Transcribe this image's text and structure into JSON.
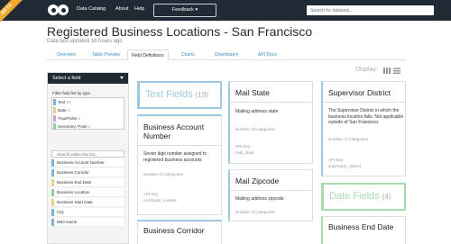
{
  "nav": {
    "beta": "BETA",
    "links": [
      "Data Catalog",
      "About",
      "Help"
    ],
    "feedback": "Feedback",
    "search_placeholder": "Search for datasets..."
  },
  "page": {
    "title": "Registered Business Locations - San Francisco",
    "updated": "Data last updated 18 hours ago"
  },
  "tabs": [
    "Overview",
    "Table Preview",
    "Field Definitions",
    "Charts",
    "Download",
    "API Docs"
  ],
  "display_label": "Display:",
  "sidebar": {
    "header": "Select a field",
    "filter_label": "Filter field list by type",
    "types": [
      {
        "label": "Text",
        "count": "19",
        "color": "#7fb3d5"
      },
      {
        "label": "Date",
        "count": "4",
        "color": "#e8d28a"
      },
      {
        "label": "True/False",
        "count": "2",
        "color": "#c3a3d9"
      },
      {
        "label": "Geometry: Point",
        "count": "1",
        "color": "#8fd19e"
      }
    ],
    "search_placeholder": "Search within this list...",
    "fields": [
      {
        "label": "Business Account Number",
        "color": "#7fb3d5"
      },
      {
        "label": "Business Corridor",
        "color": "#7fb3d5"
      },
      {
        "label": "Business End Date",
        "color": "#e8d28a"
      },
      {
        "label": "Business Location",
        "color": "#8fd19e"
      },
      {
        "label": "Business Start Date",
        "color": "#e8d28a"
      },
      {
        "label": "City",
        "color": "#7fb3d5"
      },
      {
        "label": "DBA Name",
        "color": "#7fb3d5"
      }
    ]
  },
  "cards": {
    "text_fields": {
      "title": "Text Fields",
      "count": "(19)",
      "color": "#9ec9e3"
    },
    "business_account": {
      "title": "Business Account Number",
      "desc": "Seven digit number assigned to registered business accounts",
      "meta1": "Number of Categories",
      "meta2": "API Key",
      "meta2_val": "certificate_number",
      "color": "#9ec9e3"
    },
    "business_corridor": {
      "title": "Business Corridor",
      "color": "#9ec9e3"
    },
    "mail_state": {
      "title": "Mail State",
      "desc": "Mailing address state",
      "meta1": "Number of Categories",
      "meta2": "API Key",
      "meta2_val": "mail_state",
      "color": "#9ec9e3"
    },
    "mail_zipcode": {
      "title": "Mail Zipcode",
      "desc": "Mailing address zipcode",
      "meta1": "Number of Categories",
      "color": "#9ec9e3"
    },
    "supervisor": {
      "title": "Supervisor District",
      "desc": "The Supervisor District in which the business location falls. Not applicable outside of San Francisco.",
      "meta1": "Number of Categories",
      "meta2": "API Key",
      "meta2_val": "supervisor_district",
      "color": "#9ec9e3"
    },
    "date_fields": {
      "title": "Date Fields",
      "count": "(4)",
      "color": "#a6dcae"
    },
    "business_end": {
      "title": "Business End Date",
      "color": "#a6dcae"
    }
  }
}
